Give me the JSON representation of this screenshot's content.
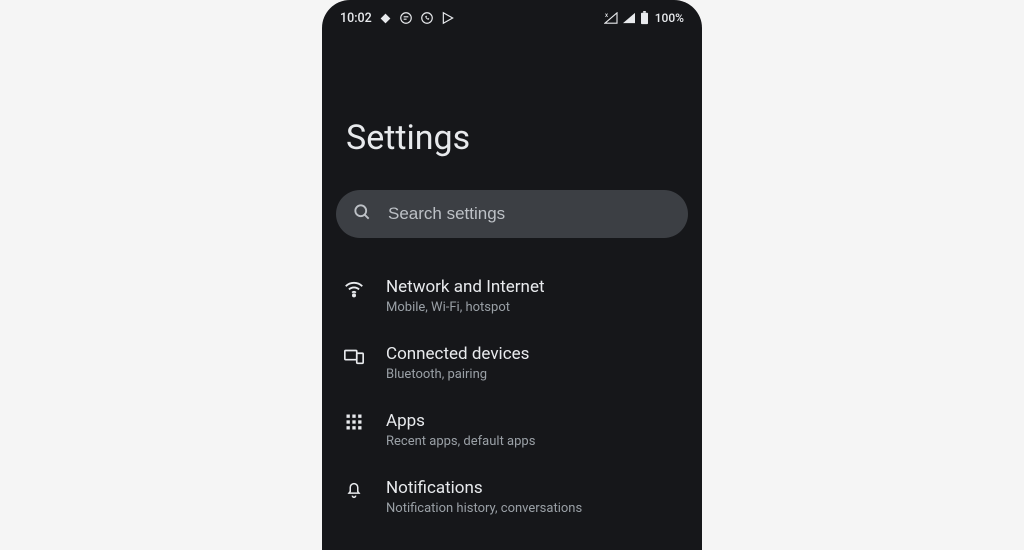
{
  "status": {
    "time": "10:02",
    "battery": "100%"
  },
  "page": {
    "title": "Settings",
    "search_placeholder": "Search settings"
  },
  "items": [
    {
      "title": "Network and Internet",
      "sub": "Mobile, Wi-Fi, hotspot"
    },
    {
      "title": "Connected devices",
      "sub": "Bluetooth, pairing"
    },
    {
      "title": "Apps",
      "sub": "Recent apps, default apps"
    },
    {
      "title": "Notifications",
      "sub": "Notification history, conversations"
    }
  ]
}
